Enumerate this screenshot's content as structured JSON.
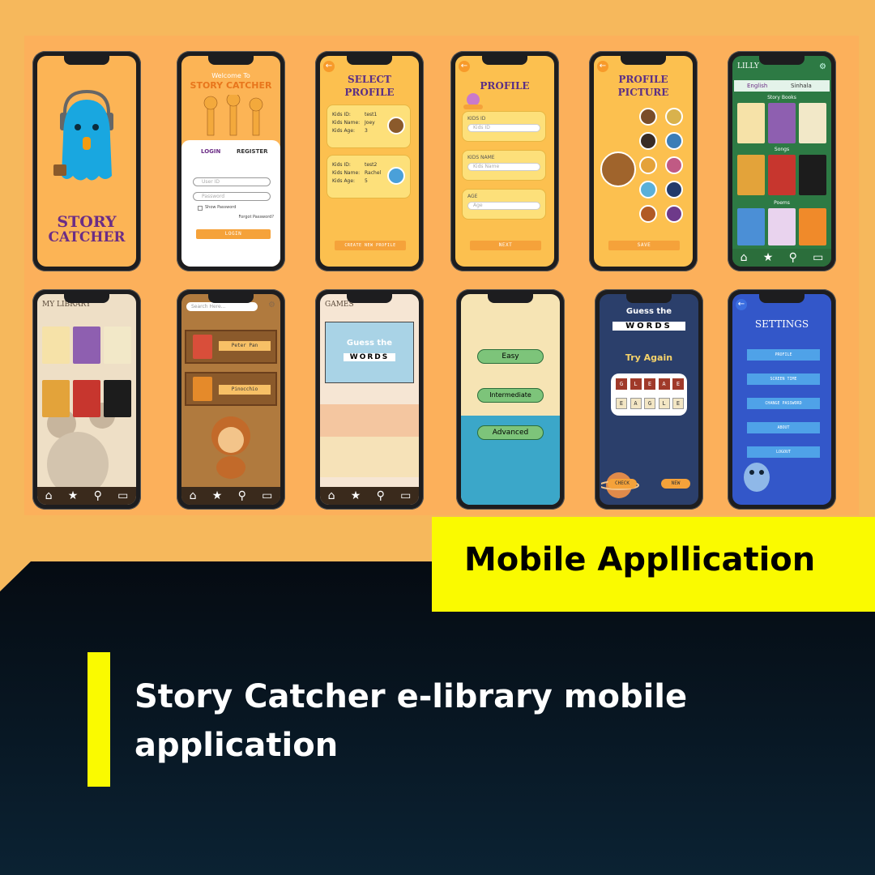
{
  "banner": {
    "title": "Mobile Appllication"
  },
  "caption": {
    "text": "Story Catcher e-library mobile application"
  },
  "colors": {
    "background": "#f6b85c",
    "panel": "#fcb05b",
    "accent_yellow": "#fafa00",
    "dark": "#061521"
  },
  "screens": {
    "splash": {
      "logo_line1": "STORY",
      "logo_line2": "CATCHER"
    },
    "login": {
      "welcome": "Welcome To",
      "app_name": "STORY CATCHER",
      "tab_login": "LOGIN",
      "tab_register": "REGISTER",
      "user_id_placeholder": "User ID",
      "password_placeholder": "Password",
      "show_password": "Show Password",
      "forgot_password": "Forgot Password?",
      "login_button": "LOGIN"
    },
    "select_profile": {
      "title_line1": "SELECT",
      "title_line2": "PROFILE",
      "kids_id_label": "Kids ID:",
      "kids_name_label": "Kids Name:",
      "kids_age_label": "Kids Age:",
      "profiles": [
        {
          "id": "test1",
          "name": "Joey",
          "age": "3"
        },
        {
          "id": "test2",
          "name": "Rachel",
          "age": "5"
        }
      ],
      "create_button": "CREATE NEW PROFILE"
    },
    "profile": {
      "title": "PROFILE",
      "kids_id_label": "KIDS ID",
      "kids_id_placeholder": "Kids ID",
      "kids_name_label": "KIDS NAME",
      "kids_name_placeholder": "Kids Name",
      "age_label": "AGE",
      "age_placeholder": "Age",
      "next_button": "NEXT"
    },
    "profile_picture": {
      "title_line1": "PROFILE",
      "title_line2": "PICTURE",
      "save_button": "SAVE"
    },
    "home": {
      "user": "LILLY",
      "lang_english": "English",
      "lang_sinhala": "Sinhala",
      "section_story_books": "Story Books",
      "section_songs": "Songs",
      "section_poems": "Poems"
    },
    "library": {
      "title": "MY LIBRARY"
    },
    "search": {
      "placeholder": "Search Here...",
      "books": [
        "Peter Pan",
        "Pinocchio"
      ]
    },
    "games": {
      "title": "GAMES",
      "card_line1": "Guess the",
      "card_line2": "WORDS"
    },
    "levels": {
      "easy": "Easy",
      "intermediate": "Intermediate",
      "advanced": "Advanced"
    },
    "word_game": {
      "title_line1": "Guess the",
      "title_line2": "WORDS",
      "status": "Try Again",
      "scrambled": [
        "G",
        "L",
        "E",
        "A",
        "E"
      ],
      "answer": [
        "E",
        "A",
        "G",
        "L",
        "E"
      ],
      "check_button": "CHECK",
      "new_button": "NEW"
    },
    "settings": {
      "title": "SETTINGS",
      "items": [
        "PROFILE",
        "SCREEN TIME",
        "CHANGE PASSWORD",
        "ABOUT",
        "LOGOUT"
      ]
    }
  }
}
